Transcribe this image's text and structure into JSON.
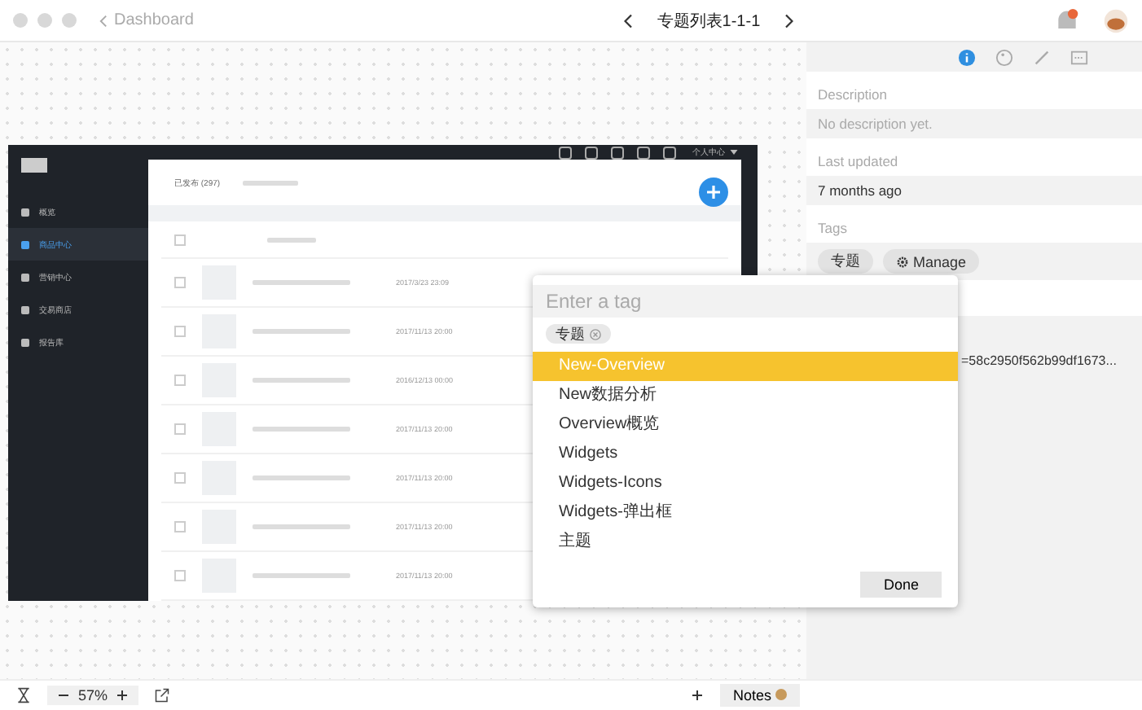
{
  "toolbar": {
    "back": "Dashboard",
    "title": "专题列表1-1-1"
  },
  "artboard": {
    "nav": [
      {
        "label": "概览",
        "selected": false
      },
      {
        "label": "商品中心",
        "selected": true
      },
      {
        "label": "营销中心",
        "selected": false
      },
      {
        "label": "交易商店",
        "selected": false
      },
      {
        "label": "报告库",
        "selected": false
      }
    ],
    "user_menu": "个人中心",
    "tab": "已发布 (297)",
    "header_checked": false,
    "rows": [
      {
        "date": "2017/3/23 23:09",
        "checked": false
      },
      {
        "date": "2017/11/13 20:00",
        "checked": false
      },
      {
        "date": "2016/12/13 00:00",
        "checked": false
      },
      {
        "date": "2017/11/13 20:00",
        "checked": false
      },
      {
        "date": "2017/11/13 20:00",
        "checked": false
      },
      {
        "date": "2017/11/13 20:00",
        "checked": false
      },
      {
        "date": "2017/11/13 20:00",
        "checked": false
      }
    ]
  },
  "inspector": {
    "tabs": [
      {
        "kind": "info",
        "selected": true
      },
      {
        "kind": "palette",
        "selected": false
      },
      {
        "kind": "pen",
        "selected": false
      },
      {
        "kind": "code",
        "selected": false
      }
    ],
    "description_label": "Description",
    "description": "No description yet.",
    "updated_label": "Last updated",
    "updated": "7 months ago",
    "tags_label": "Tags",
    "tags": [
      "专题"
    ],
    "manage": "Manage",
    "link": "=58c2950f562b99df1673..."
  },
  "tag_popup": {
    "placeholder": "Enter a tag",
    "chips": [
      "专题"
    ],
    "options": [
      {
        "label": "New-Overview",
        "selected": true
      },
      {
        "label": "New数据分析",
        "selected": false
      },
      {
        "label": "Overview概览",
        "selected": false
      },
      {
        "label": "Widgets",
        "selected": false
      },
      {
        "label": "Widgets-Icons",
        "selected": false
      },
      {
        "label": "Widgets-弹出框",
        "selected": false
      },
      {
        "label": "主题",
        "selected": false
      }
    ],
    "done": "Done"
  },
  "footer": {
    "zoom": "57%",
    "notes": "Notes"
  }
}
